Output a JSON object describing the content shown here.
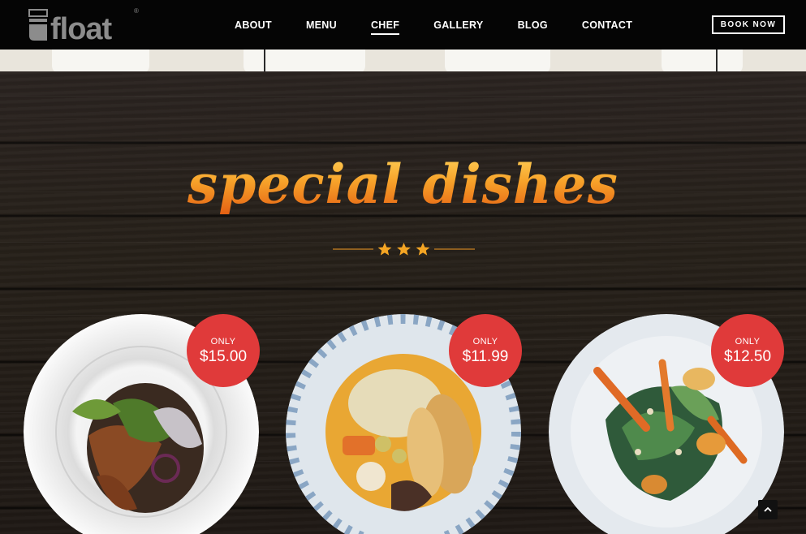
{
  "brand": {
    "name": "float",
    "registered_mark": "®"
  },
  "nav": {
    "items": [
      {
        "label": "ABOUT",
        "active": false
      },
      {
        "label": "MENU",
        "active": false
      },
      {
        "label": "CHEF",
        "active": true
      },
      {
        "label": "GALLERY",
        "active": false
      },
      {
        "label": "BLOG",
        "active": false
      },
      {
        "label": "CONTACT",
        "active": false
      }
    ],
    "book_label": "BOOK NOW"
  },
  "section": {
    "title": "special dishes",
    "stars": 3
  },
  "dishes": [
    {
      "only_label": "ONLY",
      "price": "$15.00"
    },
    {
      "only_label": "ONLY",
      "price": "$11.99"
    },
    {
      "only_label": "ONLY",
      "price": "$12.50"
    }
  ],
  "colors": {
    "navbar": "#050505",
    "accent_orange": "#f39a23",
    "badge_red": "#e03a3a",
    "wood": "#241e1a"
  },
  "icons": {
    "scroll_top": "chevron-up-icon",
    "divider_star": "star-icon"
  }
}
